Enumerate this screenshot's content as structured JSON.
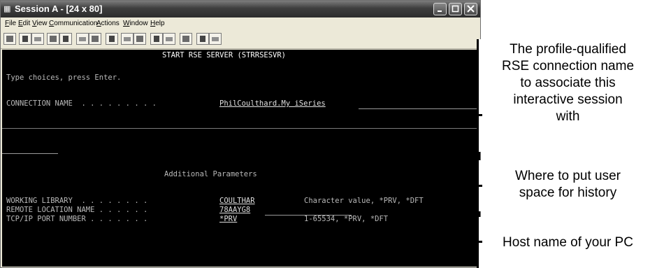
{
  "window": {
    "title": "Session A - [24 x 80]",
    "menus": [
      "File",
      "Edit",
      "View",
      "Communication",
      "Actions",
      "Window",
      "Help"
    ]
  },
  "terminal": {
    "screen_title": "START RSE SERVER (STRRSESVR)",
    "instructions": "Type choices, press Enter.",
    "connection_label": "CONNECTION NAME  . . . . . . . . .",
    "connection_value": "PhilCoulthard.My iSeries",
    "additional_header": "Additional Parameters",
    "params": [
      {
        "label": "WORKING LIBRARY  . . . . . . . .",
        "value": "COULTHAR",
        "hint": "Character value, *PRV, *DFT"
      },
      {
        "label": "REMOTE LOCATION NAME . . . . . .",
        "value": "78AAYG8",
        "hint": ""
      },
      {
        "label": "TCP/IP PORT NUMBER . . . . . . .",
        "value": "*PRV",
        "hint": "1-65534, *PRV, *DFT"
      }
    ]
  },
  "callouts": [
    {
      "lines": [
        "The profile-qualified",
        "RSE connection name",
        "to associate this",
        "interactive session",
        "with"
      ]
    },
    {
      "lines": [
        "Where to put user",
        "space for history"
      ]
    },
    {
      "lines": [
        "Host name of your PC"
      ]
    }
  ]
}
